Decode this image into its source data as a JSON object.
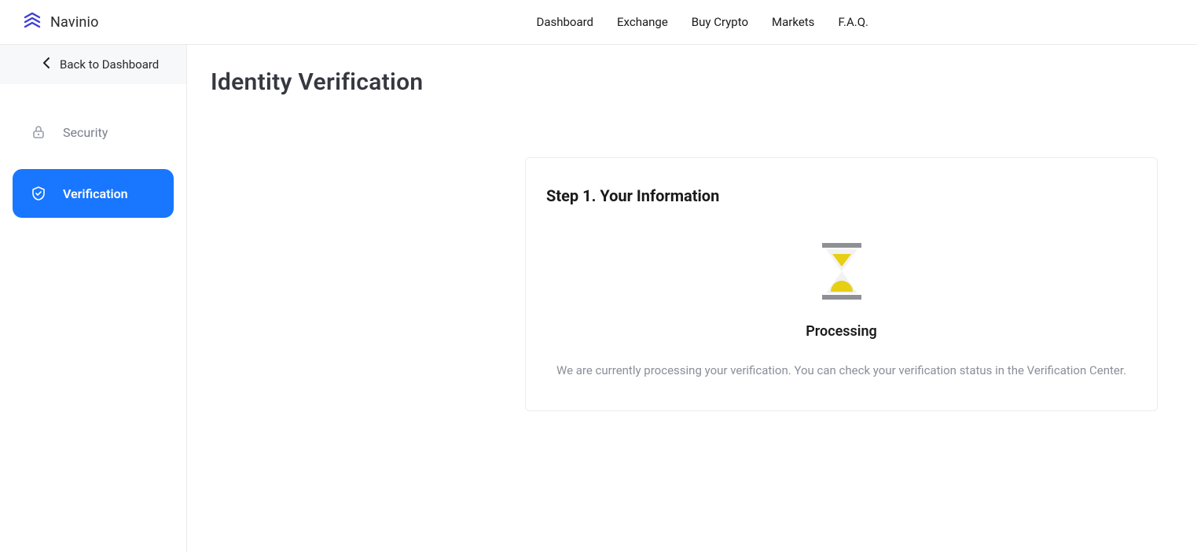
{
  "header": {
    "brand": "Navinio",
    "nav": {
      "dashboard": "Dashboard",
      "exchange": "Exchange",
      "buy_crypto": "Buy Crypto",
      "markets": "Markets",
      "faq": "F.A.Q."
    }
  },
  "sidebar": {
    "back_label": "Back to Dashboard",
    "items": {
      "security": "Security",
      "verification": "Verification"
    }
  },
  "main": {
    "title": "Identity Verification",
    "card": {
      "step_title": "Step 1. Your Information",
      "status_label": "Processing",
      "status_desc": "We are currently processing your verification. You can check your verification status in the Verification Center."
    }
  }
}
